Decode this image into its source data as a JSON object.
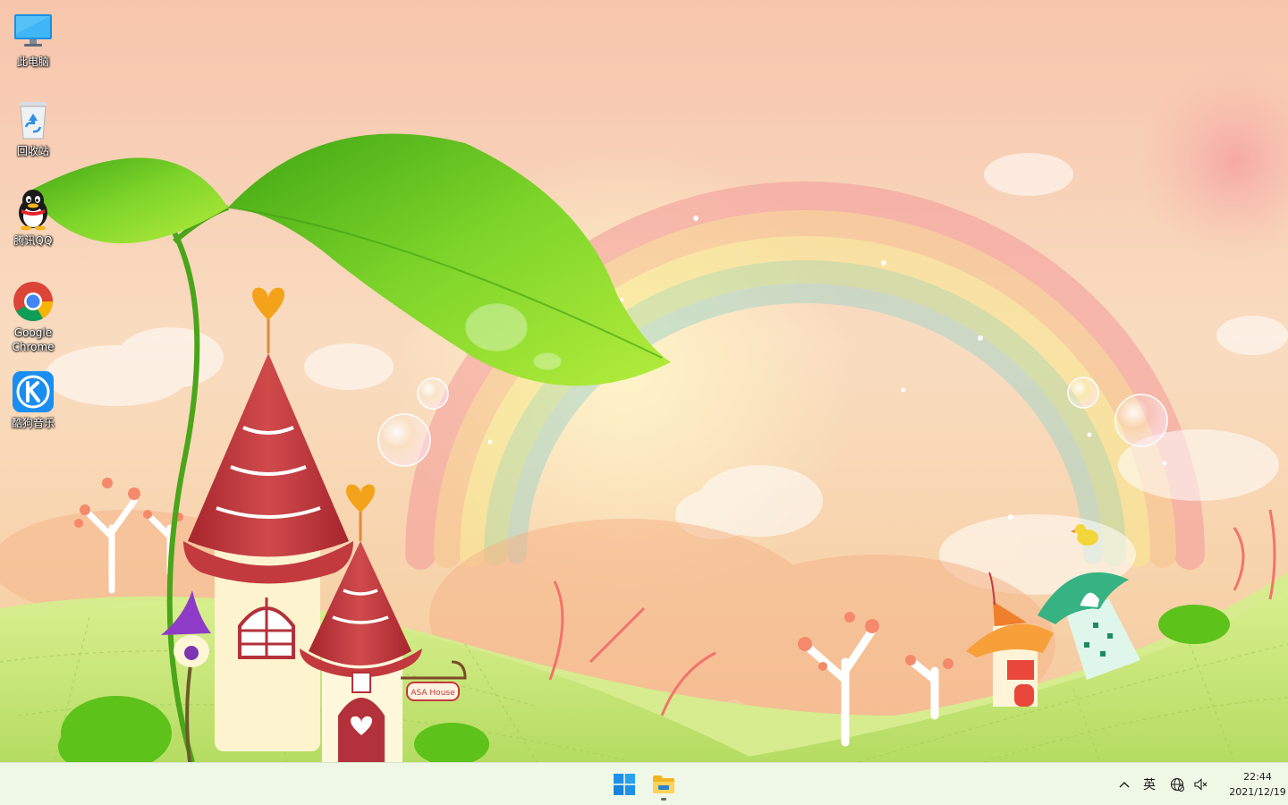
{
  "desktop": {
    "icons": [
      {
        "label": "此电脑",
        "icon": "this-pc-icon"
      },
      {
        "label": "回收站",
        "icon": "recycle-bin-icon"
      },
      {
        "label": "腾讯QQ",
        "icon": "qq-penguin-icon"
      },
      {
        "label": "Google Chrome",
        "icon": "chrome-icon"
      },
      {
        "label": "酷狗音乐",
        "icon": "kugou-music-icon"
      }
    ],
    "wallpaper": {
      "sign_text": "ASA House",
      "colors": {
        "sky_top": "#f7c9ad",
        "grass": "#c7e67a",
        "leaf": "#62c21c",
        "roof": "#c2393e"
      }
    }
  },
  "taskbar": {
    "apps": [
      {
        "icon": "windows-start-icon",
        "running": false
      },
      {
        "icon": "file-explorer-icon",
        "running": true
      }
    ],
    "tray": {
      "chevron_icon": "chevron-up-icon",
      "ime_label": "英",
      "network_icon": "network-globe-icon",
      "volume_icon": "volume-muted-icon"
    },
    "clock": {
      "time": "22:44",
      "date": "2021/12/19"
    }
  }
}
